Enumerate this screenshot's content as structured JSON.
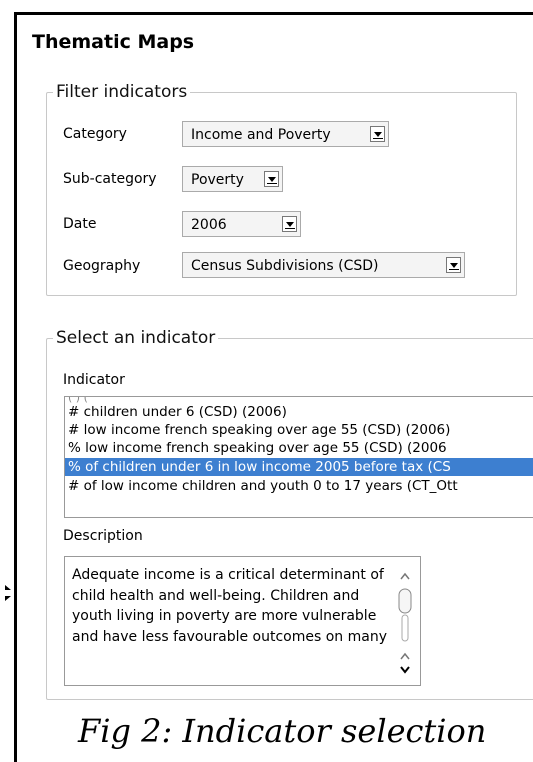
{
  "title": "Thematic Maps",
  "filter": {
    "legend": "Filter indicators",
    "category": {
      "label": "Category",
      "value": "Income and Poverty"
    },
    "subcategory": {
      "label": "Sub-category",
      "value": "Poverty"
    },
    "date": {
      "label": "Date",
      "value": "2006"
    },
    "geography": {
      "label": "Geography",
      "value": "Census Subdivisions (CSD)"
    }
  },
  "indicator_section": {
    "legend": "Select an indicator",
    "indicator_label": "Indicator",
    "items": [
      "# children under 6 (CSD) (2006)",
      "# low income french speaking over age 55 (CSD) (2006)",
      "% low income french speaking over age 55 (CSD) (2006",
      "% of children under 6 in low income 2005 before tax (CS",
      "# of low income children and youth 0 to 17 years (CT_Ott"
    ],
    "selected_index": 3,
    "description_label": "Description",
    "description": "Adequate income is a critical determinant of child health and well-being. Children and youth living in poverty are more vulnerable and have less favourable outcomes on many"
  },
  "caption": "Fig 2: Indicator selection",
  "colors": {
    "selection": "#3d7fd0",
    "border": "#c8c8c8"
  }
}
